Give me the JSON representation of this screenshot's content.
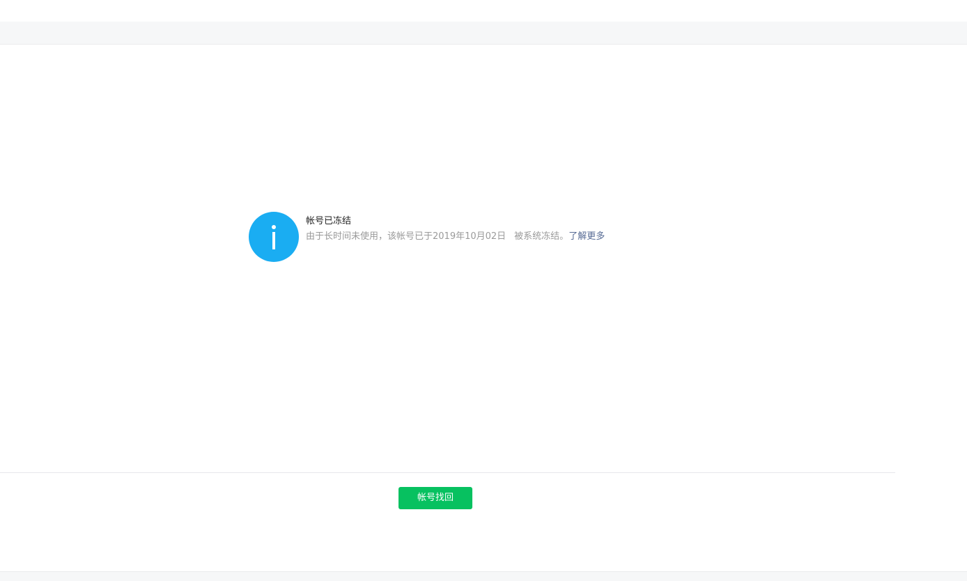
{
  "notice": {
    "icon": "info-icon",
    "title": "帐号已冻结",
    "description_main": "由于长时间未使用，该帐号已于2019年10月02日",
    "description_tail": "被系统冻结。",
    "learn_more": "了解更多"
  },
  "actions": {
    "recover_label": "帐号找回"
  },
  "colors": {
    "icon": "#1aadf2",
    "button": "#07c160",
    "link": "#576b95",
    "muted_text": "#9a9a9a",
    "band": "#f6f7f8"
  }
}
